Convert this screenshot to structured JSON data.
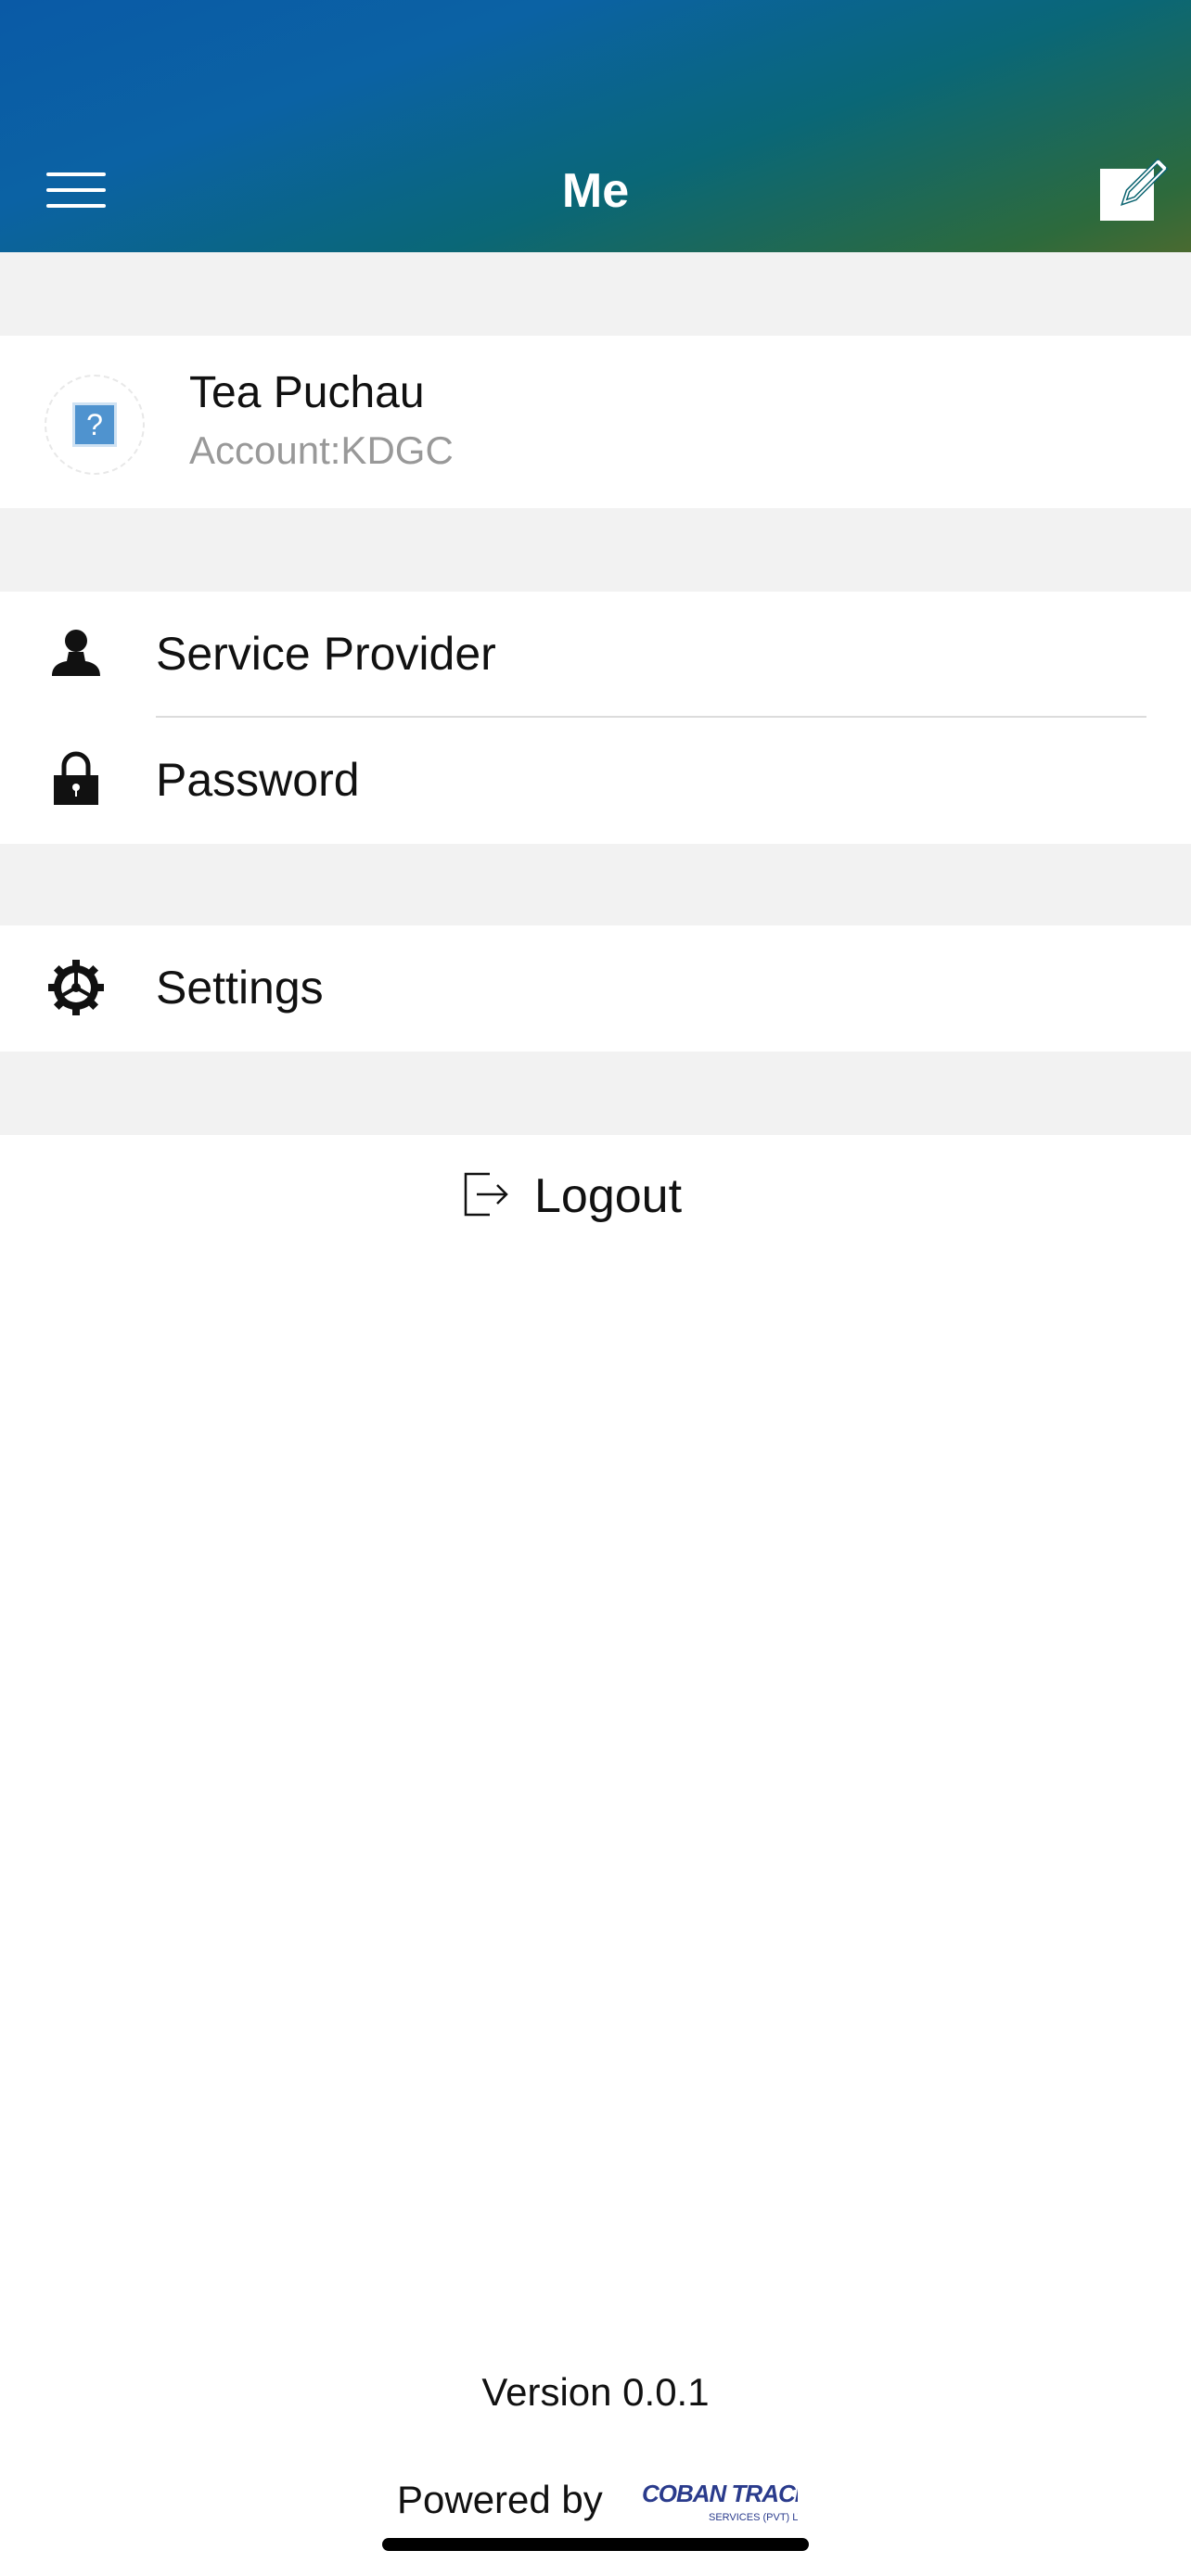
{
  "header": {
    "title": "Me",
    "menu_icon": "hamburger-menu-icon",
    "edit_icon": "edit-icon"
  },
  "profile": {
    "name": "Tea Puchau",
    "account": "Account:KDGC",
    "avatar_icon": "placeholder-avatar-icon"
  },
  "menu": {
    "items": [
      {
        "label": "Service Provider",
        "icon": "person-icon"
      },
      {
        "label": "Password",
        "icon": "lock-icon"
      }
    ]
  },
  "settings": {
    "label": "Settings",
    "icon": "gear-icon"
  },
  "logout": {
    "label": "Logout",
    "icon": "logout-icon"
  },
  "footer": {
    "version": "Version 0.0.1",
    "powered_by": "Powered by",
    "logo_text": "COBAN TRACKER",
    "logo_subtext": "SERVICES (PVT) LTD."
  },
  "colors": {
    "header_gradient_start": "#0a5aa6",
    "header_gradient_end": "#4a6a30",
    "section_gap": "#f2f2f2",
    "secondary_text": "#999999"
  }
}
